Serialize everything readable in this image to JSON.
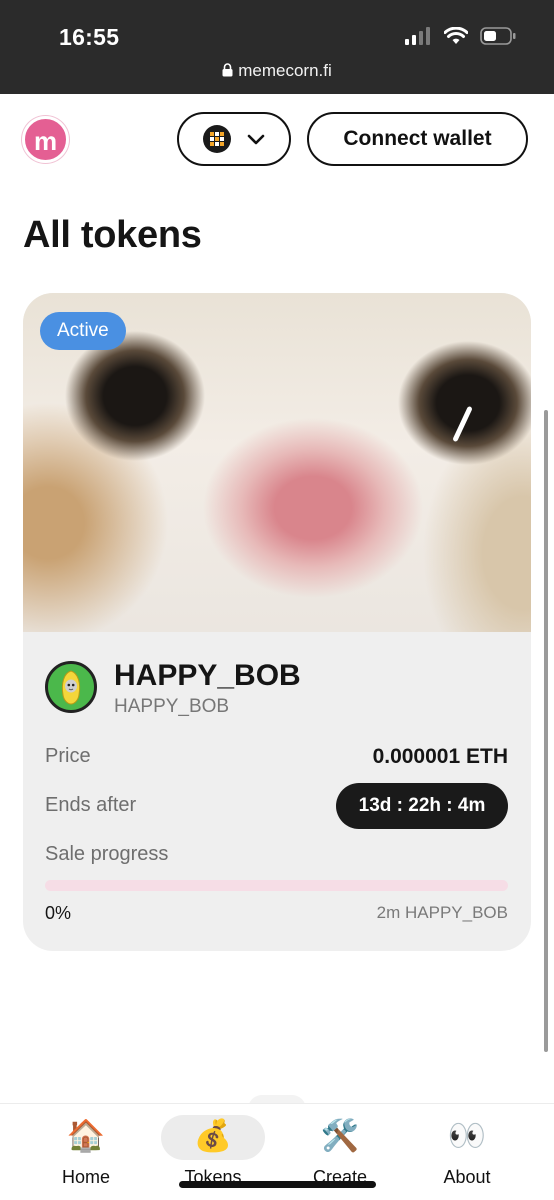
{
  "status_bar": {
    "time": "16:55",
    "url": "memecorn.fi"
  },
  "header": {
    "logo_letter": "m",
    "connect_label": "Connect wallet"
  },
  "page": {
    "title": "All tokens"
  },
  "token_card": {
    "badge": "Active",
    "name": "HAPPY_BOB",
    "symbol": "HAPPY_BOB",
    "price_label": "Price",
    "price_value": "0.000001 ETH",
    "ends_label": "Ends after",
    "ends_value": "13d : 22h : 4m",
    "progress_label": "Sale progress",
    "progress_fraction": 0,
    "progress_percent_text": "0%",
    "goal_text": "2m HAPPY_BOB"
  },
  "bottom_nav": {
    "items": [
      {
        "label": "Home",
        "icon": "🏠"
      },
      {
        "label": "Tokens",
        "icon": "💰"
      },
      {
        "label": "Create",
        "icon": "🛠️"
      },
      {
        "label": "About",
        "icon": "👀"
      }
    ]
  },
  "colors": {
    "brand_pink": "#e45f93",
    "badge_blue": "#4a90e2",
    "status_bar": "#2b2b2b"
  }
}
